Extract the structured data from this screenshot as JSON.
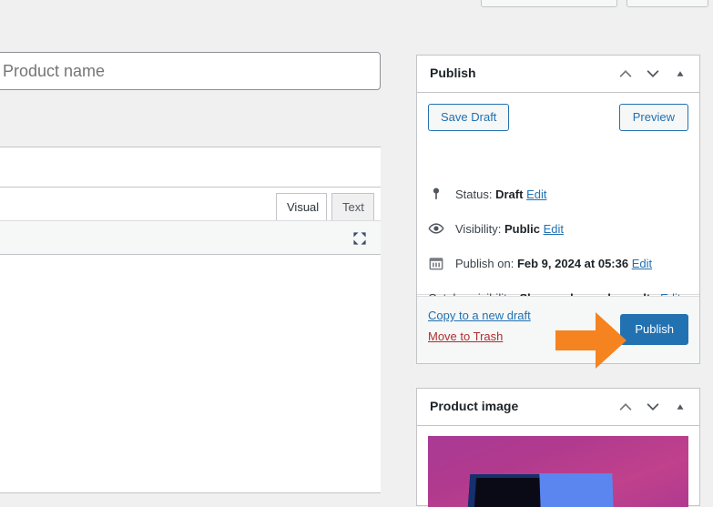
{
  "top_strip": {
    "stub_1_label": "",
    "stub_2_label": ""
  },
  "editor": {
    "title_value": "",
    "title_placeholder": "Product name",
    "tabs": [
      {
        "id": "visual",
        "label": "Visual",
        "active": true
      },
      {
        "id": "text",
        "label": "Text",
        "active": false
      }
    ],
    "fullscreen_icon": "fullscreen-expand-icon",
    "body_text": ""
  },
  "sidebar": {
    "publish_panel": {
      "title": "Publish",
      "header_icons": [
        "chevron-up-icon",
        "chevron-down-icon",
        "toggle-triangle-icon"
      ],
      "save_draft_label": "Save Draft",
      "preview_label": "Preview",
      "rows": [
        {
          "icon": "pin-icon",
          "label": "Status:",
          "value": "Draft",
          "edit_label": "Edit"
        },
        {
          "icon": "eye-icon",
          "label": "Visibility:",
          "value": "Public",
          "edit_label": "Edit"
        },
        {
          "icon": "calendar-icon",
          "label": "Publish on:",
          "value": "Feb 9, 2024 at 05:36",
          "edit_label": "Edit"
        }
      ],
      "catalog": {
        "label": "Catalog visibility:",
        "value": "Shop and search results",
        "edit_label": "Edit"
      },
      "copy_draft_label": "Copy to a new draft",
      "move_trash_label": "Move to Trash",
      "publish_label": "Publish"
    },
    "product_image_panel": {
      "title": "Product image",
      "header_icons": [
        "chevron-up-icon",
        "chevron-down-icon",
        "toggle-triangle-icon"
      ],
      "thumbnail_alt": "product-thumbnail"
    }
  },
  "annotation": {
    "arrow": "right-pointing-arrow",
    "arrow_color": "#f5831f",
    "points_at": "Publish"
  },
  "colors": {
    "page_background": "#f0f0f1",
    "panel_background": "#ffffff",
    "panel_border": "#c3c4c7",
    "link_blue": "#2271b1",
    "link_red": "#b32d2e",
    "primary_button": "#2271b1",
    "annotation_orange": "#f5831f",
    "text_dark": "#1d2327",
    "text_body": "#3c434a"
  }
}
